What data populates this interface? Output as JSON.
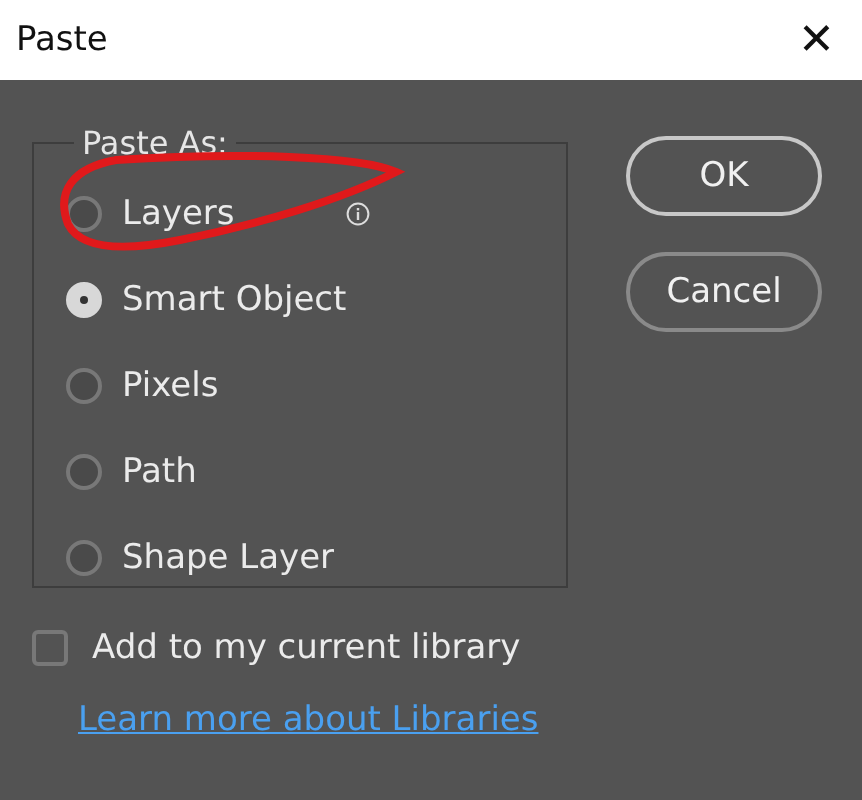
{
  "window": {
    "title": "Paste",
    "close": "✕"
  },
  "group": {
    "legend": "Paste As:",
    "options": [
      {
        "label": "Layers",
        "selected": false,
        "info": true
      },
      {
        "label": "Smart Object",
        "selected": true,
        "info": false
      },
      {
        "label": "Pixels",
        "selected": false,
        "info": false
      },
      {
        "label": "Path",
        "selected": false,
        "info": false
      },
      {
        "label": "Shape Layer",
        "selected": false,
        "info": false
      }
    ]
  },
  "library": {
    "label": "Add to my current library",
    "checked": false
  },
  "link": "Learn more about Libraries",
  "buttons": [
    "OK",
    "Cancel"
  ]
}
